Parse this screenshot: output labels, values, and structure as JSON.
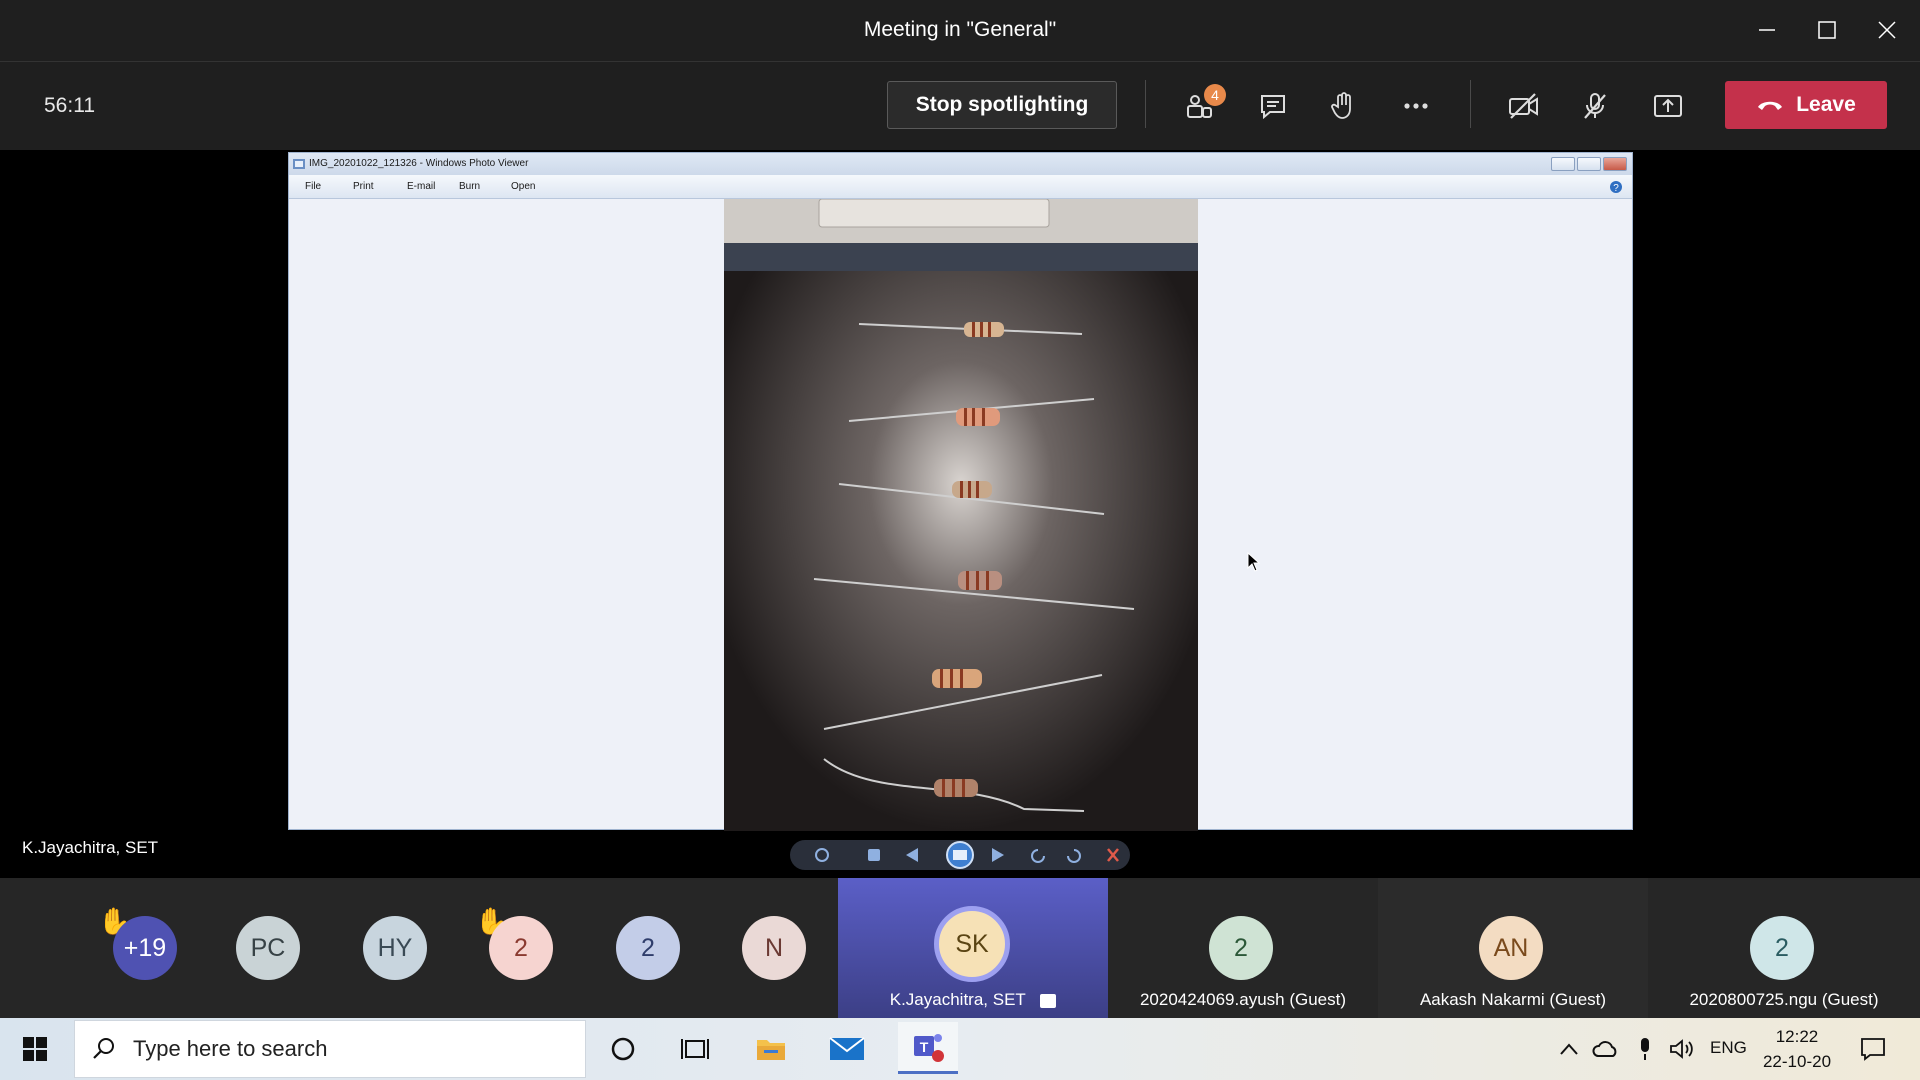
{
  "window": {
    "title": "Meeting in \"General\""
  },
  "toolbar": {
    "timer": "56:11",
    "stop_spotlight_label": "Stop spotlighting",
    "participants_badge": "4",
    "leave_label": "Leave"
  },
  "stage": {
    "photo_viewer": {
      "title": "IMG_20201022_121326 - Windows Photo Viewer",
      "menu": [
        "File",
        "Print",
        "E-mail",
        "Burn",
        "Open"
      ]
    },
    "speaker_name": "K.Jayachitra, SET"
  },
  "participants": [
    {
      "initials": "+19",
      "bg": "#4f52b2",
      "fg": "#ffffff",
      "hand": true
    },
    {
      "initials": "PC",
      "bg": "#c9d3d6",
      "fg": "#374246",
      "hand": false
    },
    {
      "initials": "HY",
      "bg": "#c8d5de",
      "fg": "#3a4a55",
      "hand": false
    },
    {
      "initials": "2",
      "bg": "#f6d4d0",
      "fg": "#8a3a30",
      "hand": true
    },
    {
      "initials": "2",
      "bg": "#c3cde8",
      "fg": "#2f3d6b",
      "hand": false
    },
    {
      "initials": "N",
      "bg": "#ead9d6",
      "fg": "#6b3a34",
      "hand": false
    }
  ],
  "video_tiles": [
    {
      "initials": "SK",
      "name": "K.Jayachitra, SET",
      "bg": "#f6e1b6",
      "fg": "#5a4413"
    },
    {
      "initials": "2",
      "name": "2020424069.ayush (Guest)",
      "bg": "#cfe3d4",
      "fg": "#2c5838"
    },
    {
      "initials": "AN",
      "name": "Aakash Nakarmi (Guest)",
      "bg": "#f3dcc2",
      "fg": "#7a4a1c"
    },
    {
      "initials": "2",
      "name": "2020800725.ngu (Guest)",
      "bg": "#cfe6e8",
      "fg": "#2a5c61"
    }
  ],
  "taskbar": {
    "search_placeholder": "Type here to search",
    "language": "ENG",
    "time": "12:22",
    "date": "22-10-20"
  },
  "colors": {
    "accent": "#6264a7",
    "leave": "#c4314b",
    "spotlight_tile": "#5b5fc7"
  }
}
